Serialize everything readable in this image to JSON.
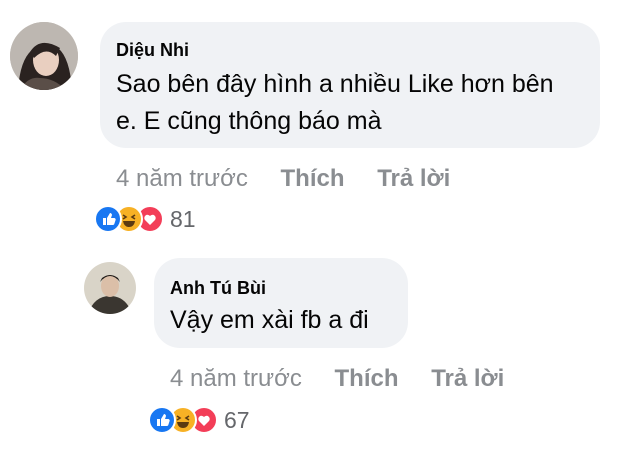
{
  "comments": [
    {
      "author": "Diệu Nhi",
      "text_lines": [
        "Sao bên đây hình a nhiều Like hơn bên",
        "e. E cũng thông báo mà"
      ],
      "time": "4 năm trước",
      "like_label": "Thích",
      "reply_label": "Trả lời",
      "reaction_count": "81",
      "reactions": [
        "like-icon",
        "haha-icon",
        "love-icon"
      ]
    },
    {
      "author": "Anh Tú Bùi",
      "text_lines": [
        "Vậy em xài fb a đi"
      ],
      "time": "4 năm trước",
      "like_label": "Thích",
      "reply_label": "Trả lời",
      "reaction_count": "67",
      "reactions": [
        "like-icon",
        "haha-icon",
        "love-icon"
      ]
    }
  ],
  "colors": {
    "bubble": "#f0f2f5",
    "meta_text": "#8a8d91",
    "like_blue": "#1877f2",
    "love_red": "#f33e58",
    "haha_yellow": "#f7b125"
  }
}
